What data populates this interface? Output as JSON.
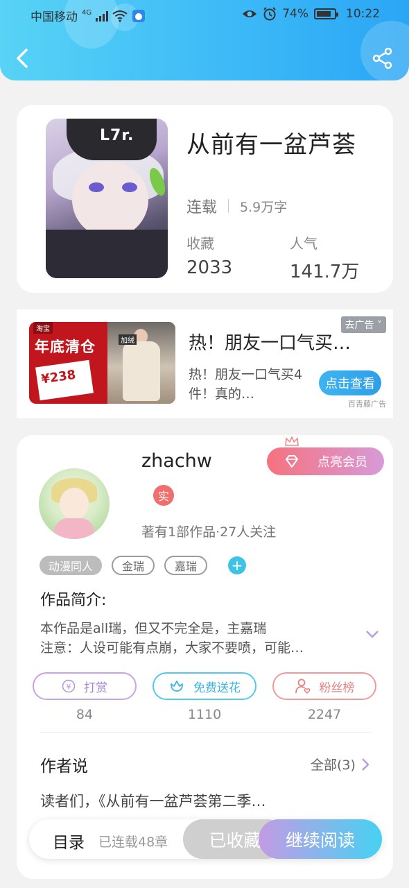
{
  "status_bar": {
    "carrier": "中国移动",
    "network": "4G",
    "battery": "74%",
    "time": "10:22"
  },
  "book": {
    "title": "从前有一盆芦荟",
    "status": "连载",
    "words": "5.9万字",
    "favorites_label": "收藏",
    "favorites": "2033",
    "popularity_label": "人气",
    "popularity": "141.7万"
  },
  "ad": {
    "image_text_main": "年底清仓",
    "image_text_tag": "淘宝",
    "image_text_price": "¥238",
    "image_text_badge": "加绒",
    "flag": "去广告",
    "title": "热！朋友一口气买…",
    "desc": "热！朋友一口气买4件！真的…",
    "button": "点击查看",
    "source": "百青藤广告"
  },
  "author": {
    "name": "zhachw",
    "verified": "实",
    "meta": "著有1部作品·27人关注",
    "vip_button": "点亮会员",
    "tags": [
      "动漫同人",
      "金瑞",
      "嘉瑞"
    ],
    "intro_heading": "作品简介:",
    "intro_line1": "本作品是all瑞，但又不完全是，主嘉瑞",
    "intro_line2": "注意：人设可能有点崩，大家不要喷，可能…"
  },
  "actions": [
    {
      "label": "打赏",
      "count": "84"
    },
    {
      "label": "免费送花",
      "count": "1110"
    },
    {
      "label": "粉丝榜",
      "count": "2247"
    }
  ],
  "author_says": {
    "heading": "作者说",
    "all_label": "全部(3)",
    "text": "读者们，《从前有一盆芦荟第二季…"
  },
  "bottom_bar": {
    "toc": "目录",
    "chapters": "已连载48章",
    "favorited": "已收藏",
    "continue": "继续阅读"
  }
}
